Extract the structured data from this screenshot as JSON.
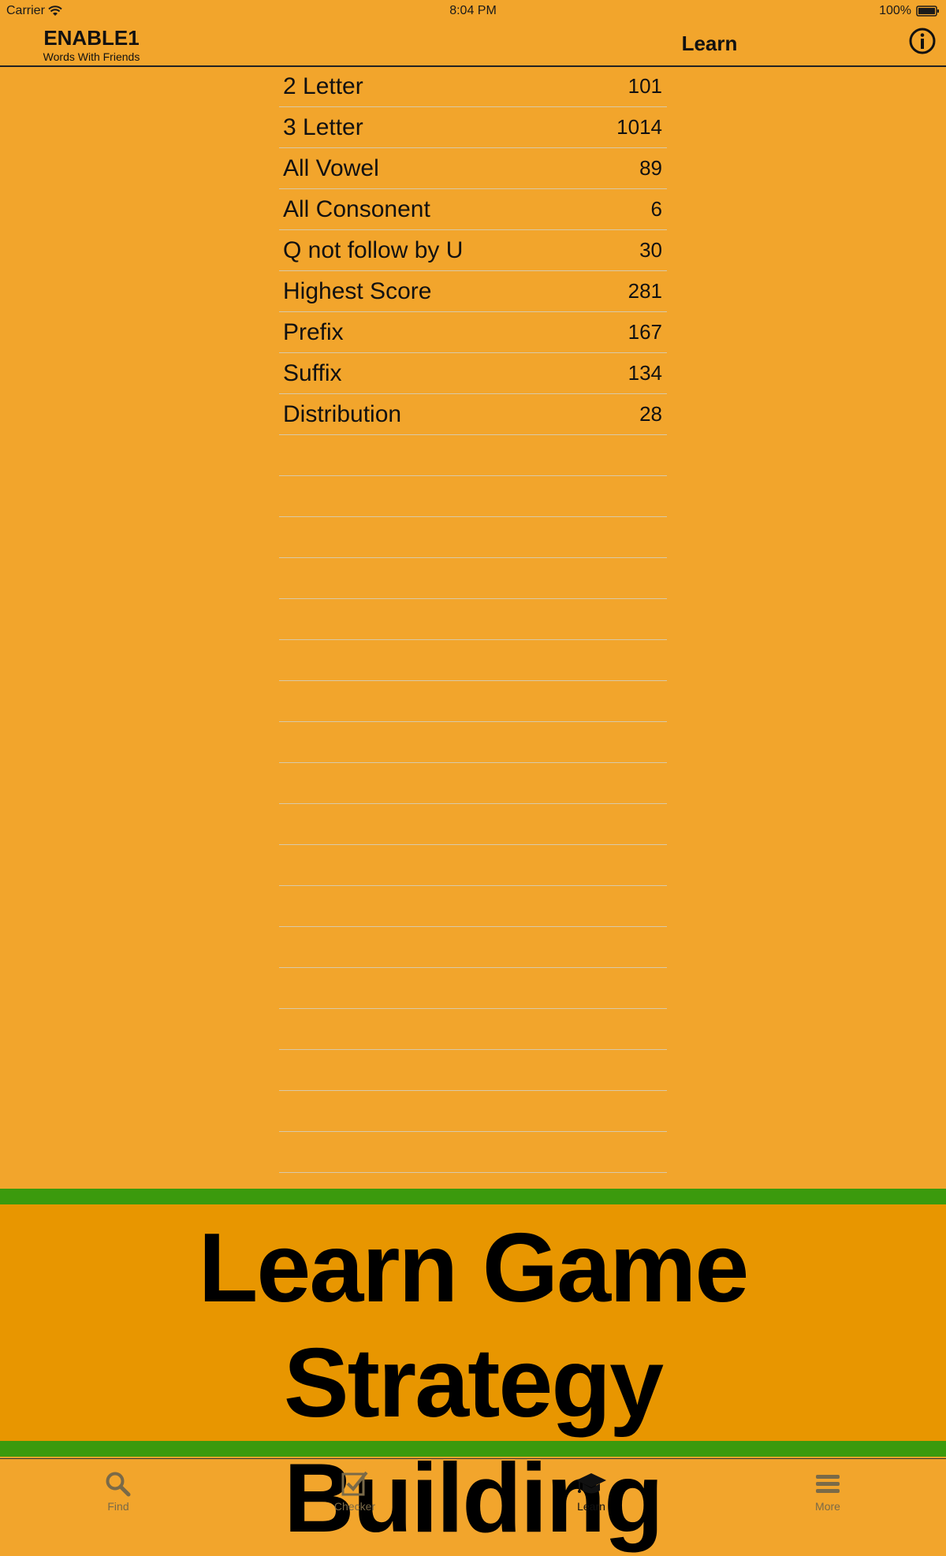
{
  "status_bar": {
    "carrier": "Carrier",
    "time": "8:04 PM",
    "battery": "100%"
  },
  "nav": {
    "brand_title": "ENABLE1",
    "brand_subtitle": "Words With Friends",
    "title": "Learn",
    "info_icon": "info-circle-icon"
  },
  "list": {
    "rows": [
      {
        "label": "2 Letter",
        "count": "101"
      },
      {
        "label": "3 Letter",
        "count": "1014"
      },
      {
        "label": "All Vowel",
        "count": "89"
      },
      {
        "label": "All Consonent",
        "count": "6"
      },
      {
        "label": "Q not follow by U",
        "count": "30"
      },
      {
        "label": "Highest Score",
        "count": "281"
      },
      {
        "label": "Prefix",
        "count": "167"
      },
      {
        "label": "Suffix",
        "count": "134"
      },
      {
        "label": "Distribution",
        "count": "28"
      }
    ]
  },
  "banner": {
    "line1": "Learn Game Strategy",
    "line2": "Building"
  },
  "tabs": [
    {
      "label": "Find",
      "icon": "search-icon"
    },
    {
      "label": "Checker",
      "icon": "checkbox-icon"
    },
    {
      "label": "Learn",
      "icon": "graduation-cap-icon",
      "active": true
    },
    {
      "label": "More",
      "icon": "menu-icon"
    }
  ],
  "colors": {
    "background": "#f2a52c",
    "banner": "#e89600",
    "stripe": "#3b9a0d"
  }
}
